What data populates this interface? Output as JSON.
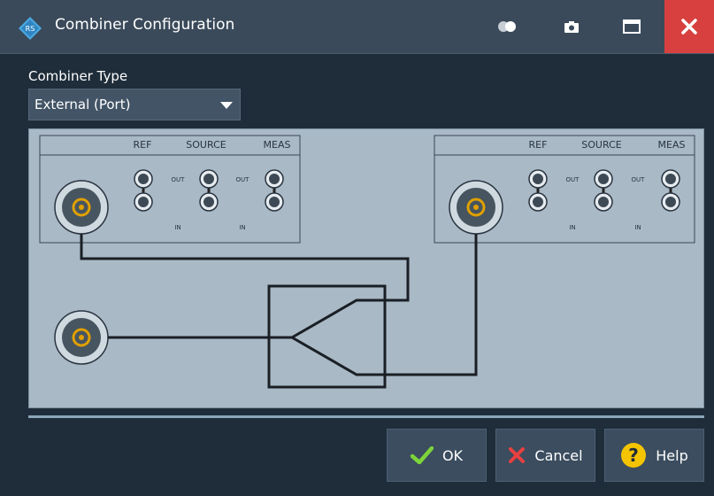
{
  "window": {
    "title": "Combiner Configuration",
    "icons": [
      "toggle-icon",
      "camera-icon",
      "maximize-icon",
      "close-icon"
    ]
  },
  "combiner": {
    "label": "Combiner Type",
    "selected": "External (Port)"
  },
  "diagram": {
    "panel_headers": [
      "REF",
      "SOURCE",
      "MEAS"
    ],
    "out_label": "OUT",
    "in_label": "IN"
  },
  "buttons": {
    "ok": "OK",
    "cancel": "Cancel",
    "help": "Help"
  },
  "colors": {
    "title_bg": "#3a4a5a",
    "body_bg": "#1f2d3a",
    "close_bg": "#d84040",
    "diagram_bg": "#a9b9c6",
    "connector_gold": "#e0a000",
    "ok_check": "#7dd43a",
    "cancel_x": "#e84040",
    "help_circle": "#f5c400"
  }
}
